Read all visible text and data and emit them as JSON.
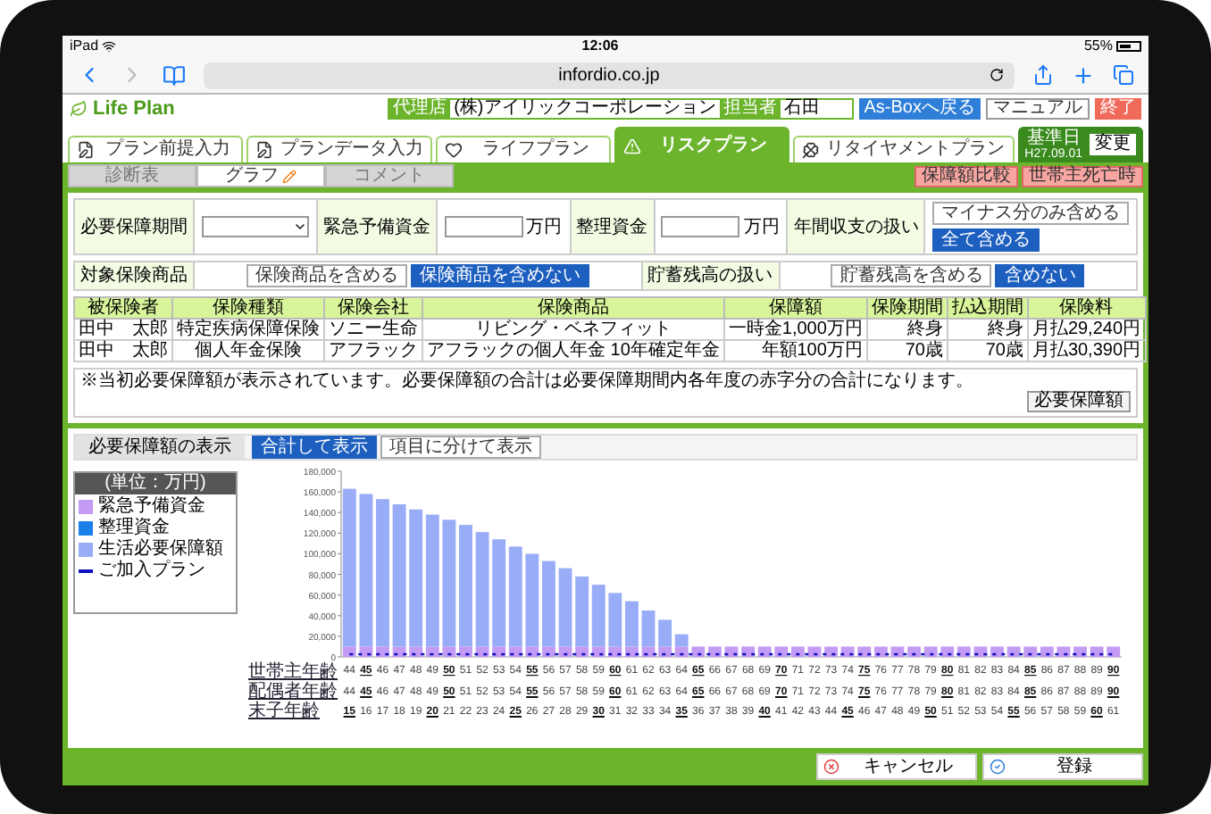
{
  "status_bar": {
    "device": "iPad",
    "time": "12:06",
    "battery": "55%"
  },
  "browser": {
    "url": "infordio.co.jp"
  },
  "header": {
    "logo": "Life Plan",
    "agency_label": "代理店",
    "agency": "(株)アイリックコーポレーション",
    "staff_label": "担当者",
    "staff": "石田",
    "buttons": [
      {
        "label": "As-Boxへ戻る",
        "kind": "primary"
      },
      {
        "label": "マニュアル",
        "kind": "manual"
      },
      {
        "label": "終了",
        "kind": "danger"
      }
    ]
  },
  "tabs": [
    {
      "label": "プラン前提入力",
      "selected": false
    },
    {
      "label": "プランデータ入力",
      "selected": false
    },
    {
      "label": "ライフプラン",
      "selected": false
    },
    {
      "label": "リスクプラン",
      "selected": true
    },
    {
      "label": "リタイヤメントプラン",
      "selected": false
    }
  ],
  "base_date": {
    "label": "基準日",
    "value": "H27.09.01",
    "button": "変更"
  },
  "subtabs": [
    {
      "label": "診断表",
      "selected": false
    },
    {
      "label": "グラフ",
      "selected": true
    },
    {
      "label": "コメント",
      "selected": false
    }
  ],
  "subtab_buttons": [
    "保障額比較",
    "世帯主死亡時"
  ],
  "form": {
    "conditions": [
      {
        "kind": "select",
        "label": "必要保障期間"
      },
      {
        "kind": "amount",
        "label": "緊急予備資金",
        "unit": "万円"
      },
      {
        "kind": "amount",
        "label": "整理資金",
        "unit": "万円"
      },
      {
        "kind": "stacked_options",
        "label": "年間収支の扱い",
        "options": [
          {
            "label": "マイナス分のみ含める",
            "selected": false
          },
          {
            "label": "全て含める",
            "selected": true
          }
        ]
      }
    ],
    "inclusions": [
      {
        "kind": "options",
        "label": "対象保険商品",
        "options": [
          {
            "label": "保険商品を含める",
            "selected": false
          },
          {
            "label": "保険商品を含めない",
            "selected": true
          }
        ]
      },
      {
        "kind": "options",
        "label": "貯蓄残高の扱い",
        "options": [
          {
            "label": "貯蓄残高を含める",
            "selected": false
          },
          {
            "label": "含めない",
            "selected": true
          }
        ]
      }
    ]
  },
  "table": {
    "columns": [
      "被保険者",
      "保険種類",
      "保険会社",
      "保険商品",
      "保障額",
      "保険期間",
      "払込期間",
      "保険料"
    ],
    "rows": [
      [
        "田中　太郎",
        "特定疾病保障保険",
        "ソニー生命",
        "リビング・ベネフィット",
        "一時金1,000万円",
        "終身",
        "終身",
        "月払29,240円"
      ],
      [
        "田中　太郎",
        "個人年金保険",
        "アフラック",
        "アフラックの個人年金 10年確定年金",
        "年額100万円",
        "70歳",
        "70歳",
        "月払30,390円"
      ]
    ]
  },
  "note": {
    "text": "※当初必要保障額が表示されています。必要保障額の合計は必要保障期間内各年度の赤字分の合計になります。",
    "button": "必要保障額"
  },
  "chart_panel": {
    "label": "必要保障額の表示",
    "options": [
      {
        "label": "合計して表示",
        "selected": true
      },
      {
        "label": "項目に分けて表示",
        "selected": false
      }
    ],
    "legend_title": "(単位：万円)",
    "chart_data": {
      "type": "bar",
      "stacked": true,
      "ylim": [
        0,
        180000
      ],
      "yticks": [
        {
          "value": 0,
          "label": "0"
        },
        {
          "value": 20000,
          "label": "20,000"
        },
        {
          "value": 40000,
          "label": "40,000"
        },
        {
          "value": 60000,
          "label": "60,000"
        },
        {
          "value": 80000,
          "label": "80,000"
        },
        {
          "value": 100000,
          "label": "100,000"
        },
        {
          "value": 120000,
          "label": "120,000"
        },
        {
          "value": 140000,
          "label": "140,000"
        },
        {
          "value": 160000,
          "label": "160,000"
        },
        {
          "value": 180000,
          "label": "180,000"
        }
      ],
      "categories": [
        "44",
        "45",
        "46",
        "47",
        "48",
        "49",
        "50",
        "51",
        "52",
        "53",
        "54",
        "55",
        "56",
        "57",
        "58",
        "59",
        "60",
        "61",
        "62",
        "63",
        "64",
        "65",
        "66",
        "67",
        "68",
        "69",
        "70",
        "71",
        "72",
        "73",
        "74",
        "75",
        "76",
        "77",
        "78",
        "79",
        "80",
        "81",
        "82",
        "83",
        "84",
        "85",
        "86",
        "87",
        "88",
        "89",
        "90"
      ],
      "series": [
        {
          "name": "緊急予備資金",
          "color": "#c39bf5",
          "values": [
            10000,
            10000,
            10000,
            10000,
            10000,
            10000,
            10000,
            10000,
            10000,
            10000,
            10000,
            10000,
            10000,
            10000,
            10000,
            10000,
            10000,
            10000,
            10000,
            10000,
            10000,
            10000,
            10000,
            10000,
            10000,
            10000,
            10000,
            10000,
            10000,
            10000,
            10000,
            10000,
            10000,
            10000,
            10000,
            10000,
            10000,
            10000,
            10000,
            10000,
            10000,
            10000,
            10000,
            10000,
            10000,
            10000,
            10000
          ]
        },
        {
          "name": "整理資金",
          "color": "#1a7fe8",
          "values": [
            0,
            0,
            0,
            0,
            0,
            0,
            0,
            0,
            0,
            0,
            0,
            0,
            0,
            0,
            0,
            0,
            0,
            0,
            0,
            0,
            0,
            0,
            0,
            0,
            0,
            0,
            0,
            0,
            0,
            0,
            0,
            0,
            0,
            0,
            0,
            0,
            0,
            0,
            0,
            0,
            0,
            0,
            0,
            0,
            0,
            0,
            0
          ]
        },
        {
          "name": "生活必要保障額",
          "color": "#99acf7",
          "values": [
            153000,
            148000,
            143000,
            138000,
            133000,
            128000,
            123000,
            118000,
            111000,
            104000,
            97000,
            90000,
            83000,
            76000,
            68000,
            60000,
            52000,
            44000,
            35000,
            26000,
            12000,
            0,
            0,
            0,
            0,
            0,
            0,
            0,
            0,
            0,
            0,
            0,
            0,
            0,
            0,
            0,
            0,
            0,
            0,
            0,
            0,
            0,
            0,
            0,
            0,
            0,
            0
          ]
        }
      ]
    },
    "plan_line": {
      "name": "ご加入プラン",
      "color": "#1010c0"
    },
    "age_rows": [
      {
        "label": "世帯主年齢",
        "emphasized": [
          false,
          true,
          false,
          false,
          false,
          false,
          true,
          false,
          false,
          false,
          false,
          true,
          false,
          false,
          false,
          false,
          true,
          false,
          false,
          false,
          false,
          true,
          false,
          false,
          false,
          false,
          true,
          false,
          false,
          false,
          false,
          true,
          false,
          false,
          false,
          false,
          true,
          false,
          false,
          false,
          false,
          true,
          false,
          false,
          false,
          false,
          true
        ]
      },
      {
        "label": "配偶者年齢",
        "values": [
          "44",
          "45",
          "46",
          "47",
          "48",
          "49",
          "50",
          "51",
          "52",
          "53",
          "54",
          "55",
          "56",
          "57",
          "58",
          "59",
          "60",
          "61",
          "62",
          "63",
          "64",
          "65",
          "66",
          "67",
          "68",
          "69",
          "70",
          "71",
          "72",
          "73",
          "74",
          "75",
          "76",
          "77",
          "78",
          "79",
          "80",
          "81",
          "82",
          "83",
          "84",
          "85",
          "86",
          "87",
          "88",
          "89",
          "90"
        ],
        "emphasized": [
          false,
          true,
          false,
          false,
          false,
          false,
          true,
          false,
          false,
          false,
          false,
          true,
          false,
          false,
          false,
          false,
          true,
          false,
          false,
          false,
          false,
          true,
          false,
          false,
          false,
          false,
          true,
          false,
          false,
          false,
          false,
          true,
          false,
          false,
          false,
          false,
          true,
          false,
          false,
          false,
          false,
          true,
          false,
          false,
          false,
          false,
          true
        ]
      },
      {
        "label": "末子年齢",
        "values": [
          "15",
          "16",
          "17",
          "18",
          "19",
          "20",
          "21",
          "22",
          "23",
          "24",
          "25",
          "26",
          "27",
          "28",
          "29",
          "30",
          "31",
          "32",
          "33",
          "34",
          "35",
          "36",
          "37",
          "38",
          "39",
          "40",
          "41",
          "42",
          "43",
          "44",
          "45",
          "46",
          "47",
          "48",
          "49",
          "50",
          "51",
          "52",
          "53",
          "54",
          "55",
          "56",
          "57",
          "58",
          "59",
          "60",
          "61"
        ],
        "emphasized": [
          true,
          false,
          false,
          false,
          false,
          true,
          false,
          false,
          false,
          false,
          true,
          false,
          false,
          false,
          false,
          true,
          false,
          false,
          false,
          false,
          true,
          false,
          false,
          false,
          false,
          true,
          false,
          false,
          false,
          false,
          true,
          false,
          false,
          false,
          false,
          true,
          false,
          false,
          false,
          false,
          true,
          false,
          false,
          false,
          false,
          true,
          false
        ]
      }
    ]
  },
  "footer_buttons": [
    {
      "label": "キャンセル",
      "kind": "cancel"
    },
    {
      "label": "登録",
      "kind": "save"
    }
  ]
}
